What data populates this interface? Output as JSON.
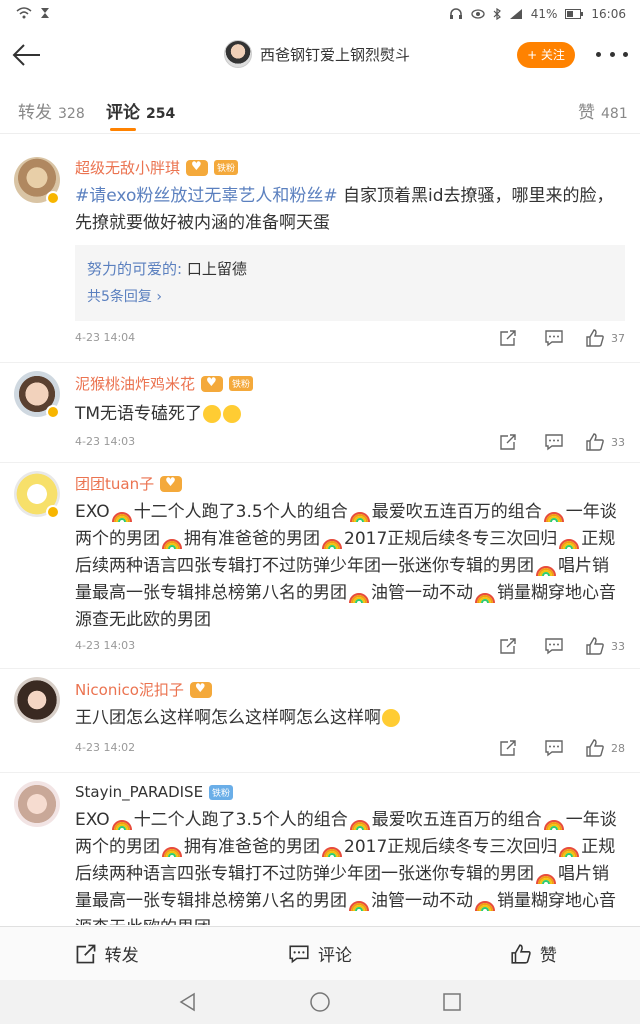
{
  "statusbar": {
    "battery": "41%",
    "time": "16:06"
  },
  "navbar": {
    "title": "西爸钢钉爱上钢烈熨斗",
    "follow": "+ 关注"
  },
  "tabs": [
    {
      "label": "转发",
      "count": "328"
    },
    {
      "label": "评论",
      "count": "254"
    },
    {
      "label": "赞",
      "count": "481"
    }
  ],
  "comments": [
    {
      "user": "超级无敌小胖琪",
      "badge": "铁粉",
      "hashtag": "#请exo粉丝放过无辜艺人和粉丝#",
      "text": " 自家顶着黑id去撩骚，哪里来的脸，先撩就要做好被内涵的准备啊天蛋",
      "reply_name": "努力的可爱的:",
      "reply_text": " 口上留德",
      "reply_more": "共5条回复 ›",
      "time": "4-23 14:04",
      "likes": "37"
    },
    {
      "user": "泥猴桃油炸鸡米花",
      "badge": "铁粉",
      "text": "TM无语专磕死了",
      "time": "4-23 14:03",
      "likes": "33"
    },
    {
      "user": "团团tuan子",
      "text_parts": [
        "EXO",
        "十二个人跑了3.5个人的组合",
        "最爱吹五连百万的组合",
        "一年谈两个的男团",
        "拥有准爸爸的男团",
        "2017正规后续冬专三次回归",
        "正规后续两种语言四张专辑打不过防弹少年团一张迷你专辑的男团",
        "唱片销量最高一张专辑排总榜第八名的男团",
        "油管一动不动",
        "销量糊穿地心音源查无此欧的男团"
      ],
      "time": "4-23 14:03",
      "likes": "33"
    },
    {
      "user": "Niconico泥扣子",
      "text": "王八团怎么这样啊怎么这样啊怎么这样啊",
      "time": "4-23 14:02",
      "likes": "28"
    },
    {
      "user": "Stayin_PARADISE",
      "badge": "铁粉",
      "text_parts": [
        "EXO",
        "十二个人跑了3.5个人的组合",
        "最爱吹五连百万的组合",
        "一年谈两个的男团",
        "拥有准爸爸的男团",
        "2017正规后续冬专三次回归",
        "正规后续两种语言四张专辑打不过防弹少年团一张迷你专辑的男团",
        "唱片销量最高一张专辑排总榜第八名的男团",
        "油管一动不动",
        "销量糊穿地心音源查无此欧的男团"
      ]
    }
  ],
  "bottombar": {
    "repost": "转发",
    "comment": "评论",
    "like": "赞"
  },
  "colors": {
    "accent": "#ff8200",
    "username": "#eb7350",
    "link": "#5b80bf"
  }
}
